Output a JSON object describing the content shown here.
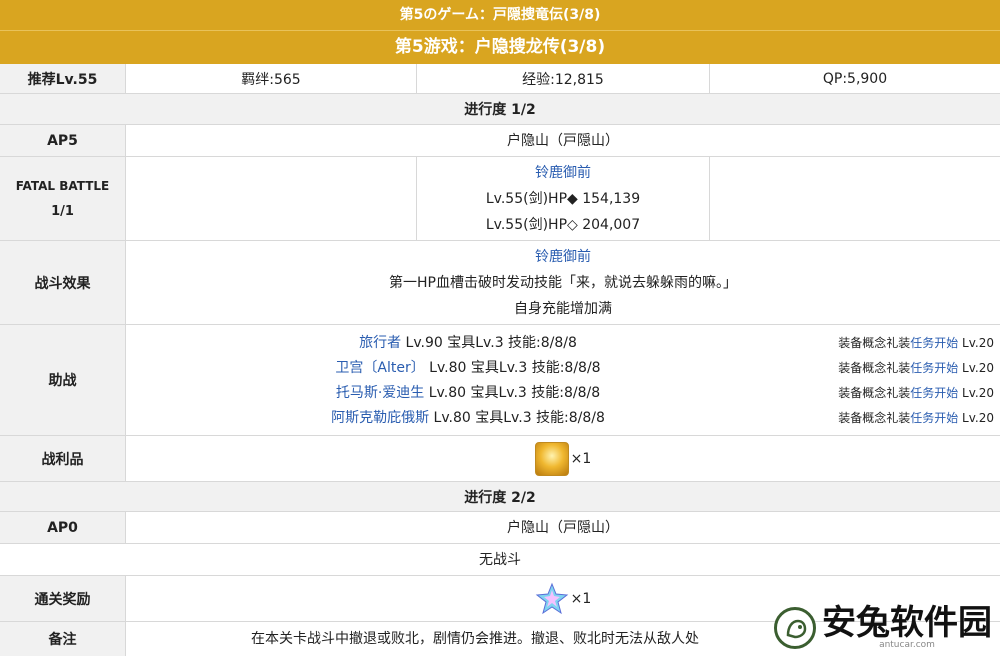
{
  "header": {
    "title_jp": "第5のゲーム：戸隠捜竜伝(3/8)",
    "title_cn": "第5游戏：户隐搜龙传(3/8)"
  },
  "summary": {
    "recommended": "推荐Lv.55",
    "bond": "羁绊:565",
    "exp": "经验:12,815",
    "qp": "QP:5,900"
  },
  "progress1": {
    "title": "进行度 1/2",
    "ap_label": "AP5",
    "location": "户隐山（戸隠山）",
    "fatal_label_1": "FATAL BATTLE",
    "fatal_label_2": "1/1",
    "enemy_name": "铃鹿御前",
    "enemy_hp1": "Lv.55(剑)HP◆ 154,139",
    "enemy_hp2": "Lv.55(剑)HP◇ 204,007",
    "effect_label": "战斗效果",
    "effect_name": "铃鹿御前",
    "effect_line1": "第一HP血槽击破时发动技能「来，就说去躲躲雨的嘛。」",
    "effect_line2": "自身充能增加满",
    "support_label": "助战",
    "supports": [
      {
        "name": "旅行者",
        "stats": " Lv.90 宝具Lv.3 技能:8/8/8",
        "ce_prefix": "装备概念礼装",
        "ce_link": "任务开始",
        "ce_lv": " Lv.20"
      },
      {
        "name": "卫宫〔Alter〕",
        "stats": " Lv.80 宝具Lv.3 技能:8/8/8",
        "ce_prefix": "装备概念礼装",
        "ce_link": "任务开始",
        "ce_lv": " Lv.20"
      },
      {
        "name": "托马斯·爱迪生",
        "stats": " Lv.80 宝具Lv.3 技能:8/8/8",
        "ce_prefix": "装备概念礼装",
        "ce_link": "任务开始",
        "ce_lv": " Lv.20"
      },
      {
        "name": "阿斯克勒庇俄斯",
        "stats": " Lv.80 宝具Lv.3 技能:8/8/8",
        "ce_prefix": "装备概念礼装",
        "ce_link": "任务开始",
        "ce_lv": " Lv.20"
      }
    ],
    "loot_label": "战利品",
    "loot_count": "×1",
    "loot_icon": "gold-statue-icon"
  },
  "progress2": {
    "title": "进行度 2/2",
    "ap_label": "AP0",
    "location": "户隐山（戸隠山）",
    "no_battle": "无战斗"
  },
  "reward": {
    "label": "通关奖励",
    "count": "×1",
    "icon": "saint-quartz-icon"
  },
  "notes": {
    "label": "备注",
    "text": "在本关卡战斗中撤退或败北，剧情仍会推进。撤退、败北时无法从敌人处"
  },
  "watermark": {
    "text": "安兔软件园",
    "url": "antucar.com"
  }
}
